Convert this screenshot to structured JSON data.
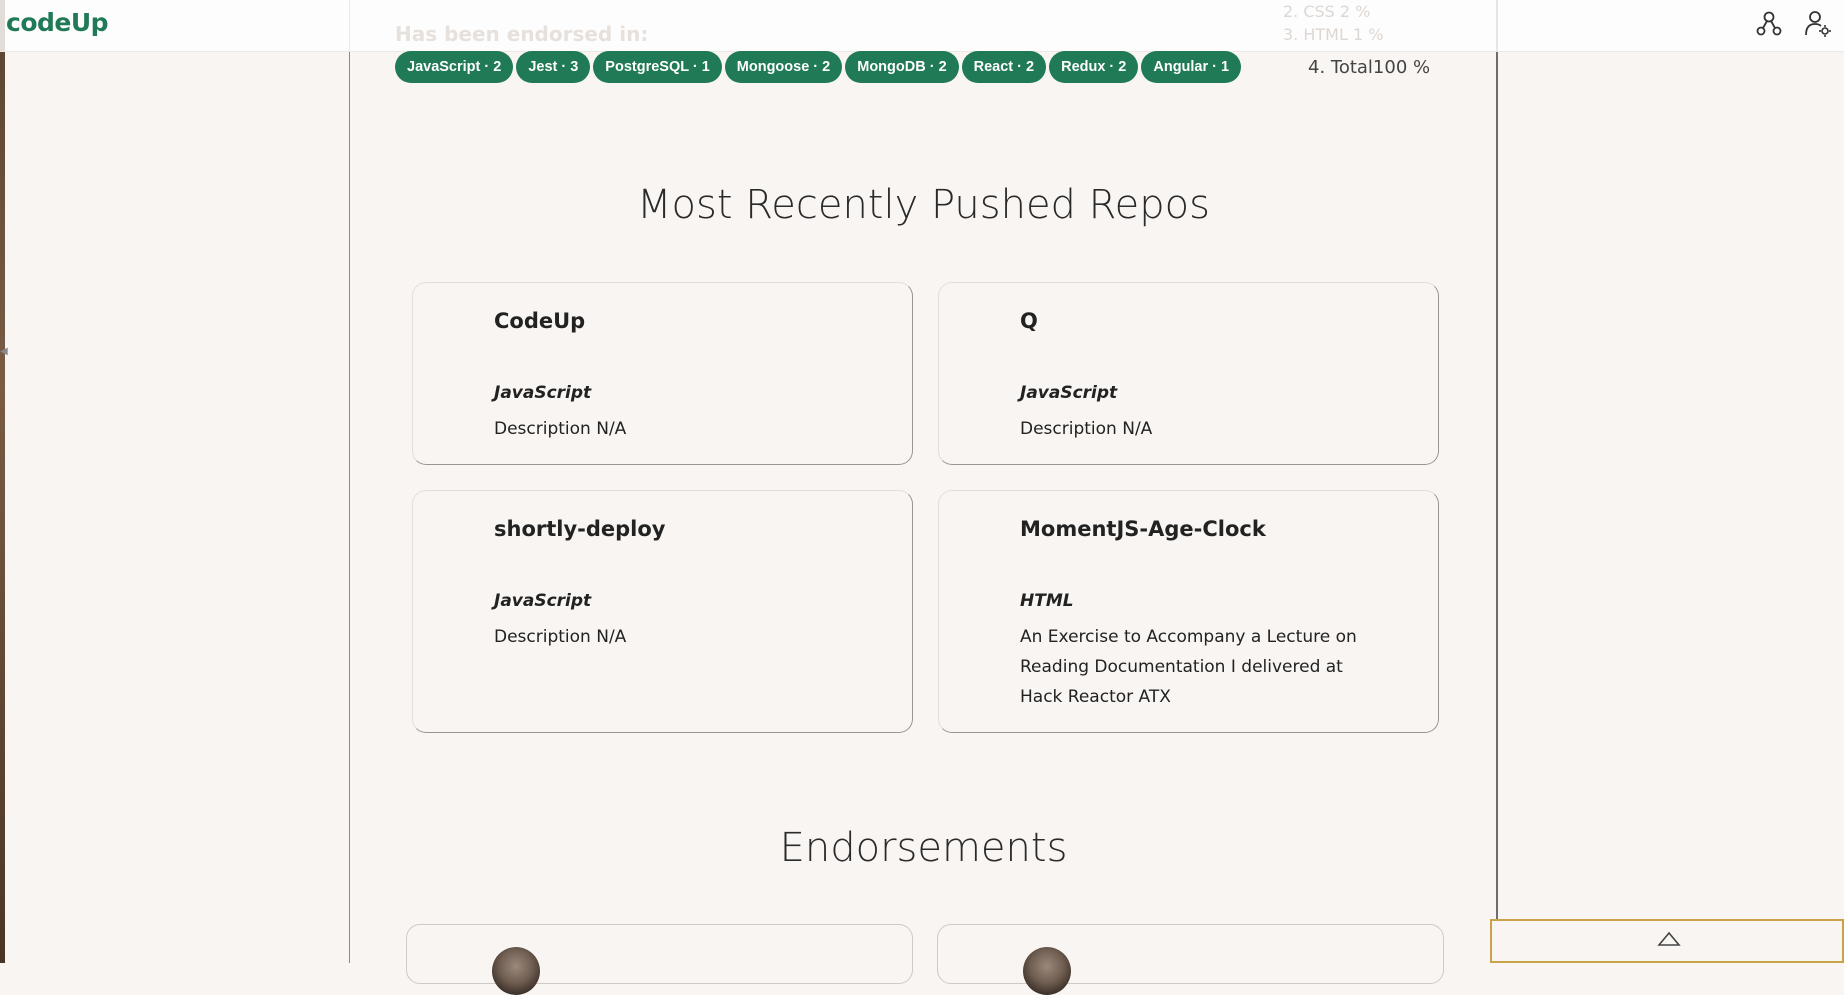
{
  "app": {
    "logo": "codeUp"
  },
  "profile": {
    "endorsed_label": "Has been endorsed in:",
    "endorsements": [
      {
        "label": "JavaScript · 2"
      },
      {
        "label": "Jest · 3"
      },
      {
        "label": "PostgreSQL · 1"
      },
      {
        "label": "Mongoose · 2"
      },
      {
        "label": "MongoDB · 2"
      },
      {
        "label": "React · 2"
      },
      {
        "label": "Redux · 2"
      },
      {
        "label": "Angular · 1"
      }
    ],
    "languages_ghost": [
      {
        "text": "2.   CSS   2 %"
      },
      {
        "text": "3.   HTML   1 %"
      }
    ],
    "total": "4. Total100 %"
  },
  "repos_section": {
    "title": "Most Recently Pushed Repos",
    "repos": [
      {
        "name": "CodeUp",
        "language": "JavaScript",
        "description": "Description N/A"
      },
      {
        "name": "Q",
        "language": "JavaScript",
        "description": "Description N/A"
      },
      {
        "name": "shortly-deploy",
        "language": "JavaScript",
        "description": "Description N/A"
      },
      {
        "name": "MomentJS-Age-Clock",
        "language": "HTML",
        "description": "An Exercise to Accompany a Lecture on Reading Documentation I delivered at Hack Reactor ATX"
      }
    ]
  },
  "endorsements_section": {
    "title": "Endorsements"
  },
  "icons": {
    "network": "network-icon",
    "user_settings": "user-settings-icon",
    "scroll_top": "chevron-up-icon"
  },
  "colors": {
    "brand": "#1f7a55",
    "background": "#f9f5f2",
    "scroll_border": "#c9a24a"
  }
}
